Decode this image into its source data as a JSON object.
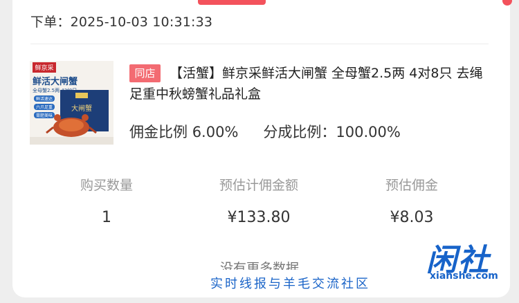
{
  "order": {
    "label": "下单：",
    "datetime": "2025-10-03 10:31:33"
  },
  "product": {
    "badge": "同店",
    "title": "【活蟹】鲜京采鲜活大闸蟹 全母蟹2.5两 4对8只 去绳足重中秋螃蟹礼品礼盒",
    "image": {
      "brand": "鲜京采",
      "name": "鲜活大闸蟹",
      "spec": "全母蟹2.5两 4对8只",
      "tags": [
        "鲜活速达",
        "六爪足重",
        "膏肥美味"
      ],
      "box_label": "大闸蟹"
    },
    "commission_rate_label": "佣金比例",
    "commission_rate": "6.00%",
    "share_ratio_label": "分成比例：",
    "share_ratio": "100.00%"
  },
  "stats": {
    "headers": [
      "购买数量",
      "预估计佣金额",
      "预估佣金"
    ],
    "values": [
      "1",
      "¥133.80",
      "¥8.03"
    ]
  },
  "footer": {
    "no_more": "没有更多数据"
  },
  "watermark": {
    "logo": "闲社",
    "url": "xianshe.com",
    "slogan": "实时线报与羊毛交流社区"
  },
  "colors": {
    "accent": "#f3525c",
    "badge": "#f36b72",
    "watermark": "#1763c9"
  }
}
